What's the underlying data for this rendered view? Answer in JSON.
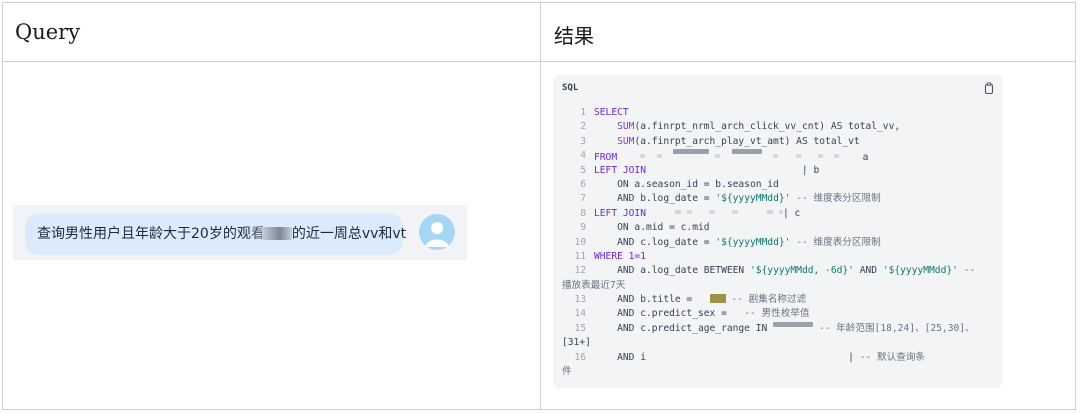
{
  "table": {
    "header_query": "Query",
    "header_result": "结果"
  },
  "chat": {
    "message_before": "查询男性用户且年龄大于20岁的观",
    "message_partial": "看",
    "message_after": "的近一周总vv和vt"
  },
  "code_panel": {
    "language": "SQL",
    "copy_icon": "copy-icon",
    "lines": {
      "l1": "SELECT",
      "l2_fn": "SUM",
      "l2_rest": "(a.finrpt_nrml_arch_click_vv_cnt) AS total_vv,",
      "l3_fn": "SUM",
      "l3_rest": "(a.finrpt_arch_play_vt_amt) AS total_vt",
      "l4_kw": "FROM",
      "l4_tail": "a",
      "l5_kw": "LEFT JOIN",
      "l5_tail": "b",
      "l6": "ON a.season_id = b.season_id",
      "l7_code": "AND b.log_date = ",
      "l7_str": "'${yyyyMMdd}'",
      "l7_cm": "-- 维度表分区限制",
      "l8_kw": "LEFT JOIN",
      "l8_tail": "c",
      "l9": "ON a.mid = c.mid",
      "l10_code": "AND c.log_date = ",
      "l10_str": "'${yyyyMMdd}'",
      "l10_cm": "-- 维度表分区限制",
      "l11": "WHERE 1=1",
      "l12_code": "AND a.log_date BETWEEN ",
      "l12_str1": "'${yyyyMMdd, -6d}'",
      "l12_and": " AND ",
      "l12_str2": "'${yyyyMMdd}'",
      "l12_cm": "--",
      "l12_wrap": "播放表最近7天",
      "l13_code": "AND b.title = ",
      "l13_cm": "-- 剧集名称过滤",
      "l14_code": "AND c.predict_sex =",
      "l14_cm": "-- 男性枚举值",
      "l15_code": "AND c.predict_age_range IN",
      "l15_cm": "-- 年龄范围[18,24]、[25,30]、",
      "l15_wrap": "[31+]",
      "l16_code": "AND i",
      "l16_cm": "-- 默认查询条",
      "l16_wrap": "件"
    }
  },
  "colors": {
    "bubble": "#dcebfb",
    "strip": "#f1f3f7",
    "code_bg": "#f3f4f6",
    "keyword": "#6d28d9",
    "string": "#0f766e"
  }
}
